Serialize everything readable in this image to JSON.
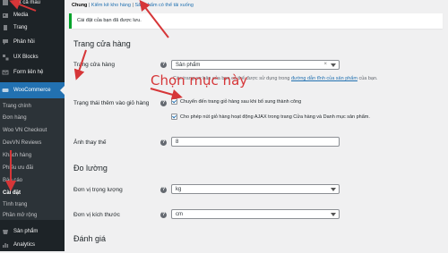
{
  "colors": {
    "sidebar_bg": "#1d2327",
    "sidebar_sub_bg": "#2c3338",
    "active": "#2271b1",
    "annotation": "#d63638",
    "notice_border": "#00a32a"
  },
  "sidebar": {
    "items": [
      {
        "label": "Tất cả mẫu",
        "icon": "templates-icon"
      },
      {
        "label": "Media",
        "icon": "media-icon"
      },
      {
        "label": "Trang",
        "icon": "page-icon"
      },
      {
        "label": "Phản hồi",
        "icon": "comments-icon"
      },
      {
        "label": "UX Blocks",
        "icon": "blocks-icon"
      },
      {
        "label": "Form liên hệ",
        "icon": "mail-icon"
      },
      {
        "label": "WooCommerce",
        "icon": "woocommerce-icon"
      }
    ],
    "submenu": [
      "Trang chính",
      "Đơn hàng",
      "Woo VN Checkout",
      "DevVN Reviews",
      "Khách hàng",
      "Phiếu ưu đãi",
      "Báo cáo",
      "Cài đặt",
      "Tình trạng",
      "Phần mở rộng"
    ],
    "current_sub": "Cài đặt",
    "bottom_items": [
      {
        "label": "Sản phẩm",
        "icon": "products-icon"
      },
      {
        "label": "Analytics",
        "icon": "analytics-icon"
      }
    ]
  },
  "tabs": {
    "current": "Chung",
    "sep1": " | ",
    "link1": "Kiểm kê kho hàng",
    "sep2": " | ",
    "link2": "Sản phẩm có thể tải xuống"
  },
  "notice": "Cài đặt của bạn đã được lưu.",
  "store_section": {
    "heading": "Trang cửa hàng",
    "shop_page_label": "Trang cửa hàng",
    "shop_page_value": "Sản phẩm",
    "shop_page_desc_prefix": "Các trang cơ bản của bạn có thể được sử dụng trong ",
    "shop_page_desc_link": "đường dẫn tĩnh của sản phẩm",
    "shop_page_desc_suffix": " của bạn.",
    "add_to_cart_label": "Trạng thái thêm vào giỏ hàng",
    "checkbox1": "Chuyển đến trang giỏ hàng sau khi bổ sung thành công",
    "checkbox2": "Cho phép nút giỏ hàng hoạt động AJAX trong trang Cửa hàng và Danh mục sản phẩm.",
    "placeholder_label": "Ảnh thay thế",
    "placeholder_value": "8"
  },
  "measure_section": {
    "heading": "Đo lường",
    "weight_label": "Đơn vị trọng lượng",
    "weight_value": "kg",
    "dimension_label": "Đơn vị kích thước",
    "dimension_value": "cm"
  },
  "reviews_heading": "Đánh giá",
  "annotation_text": "Chọn mục này"
}
